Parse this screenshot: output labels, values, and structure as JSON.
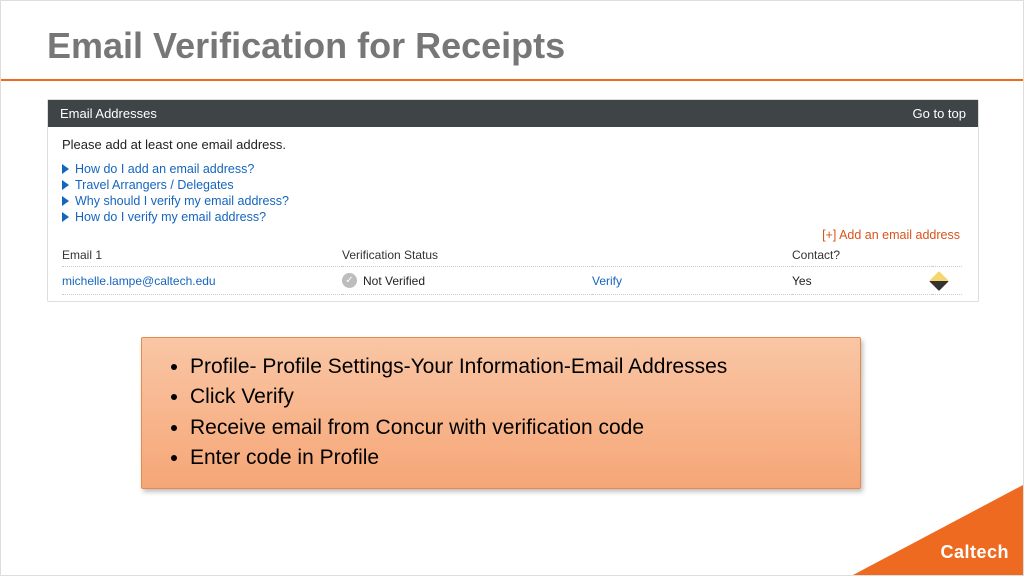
{
  "title": "Email Verification for Receipts",
  "panel": {
    "header": "Email Addresses",
    "go_to_top": "Go to top",
    "prompt": "Please add at least one email address.",
    "help_links": [
      "How do I add an email address?",
      "Travel Arrangers / Delegates",
      "Why should I verify my email address?",
      "How do I verify my email address?"
    ],
    "add_link": "[+] Add an email address",
    "columns": {
      "email": "Email 1",
      "status": "Verification Status",
      "verify": "",
      "contact": "Contact?"
    },
    "row": {
      "email": "michelle.lampe@caltech.edu",
      "status": "Not Verified",
      "verify": "Verify",
      "contact": "Yes"
    }
  },
  "callout": {
    "items": [
      "Profile- Profile Settings-Your Information-Email Addresses",
      "Click Verify",
      "Receive email from Concur with verification code",
      "Enter code in Profile"
    ]
  },
  "brand": "Caltech",
  "icons": {
    "check": "✓"
  }
}
